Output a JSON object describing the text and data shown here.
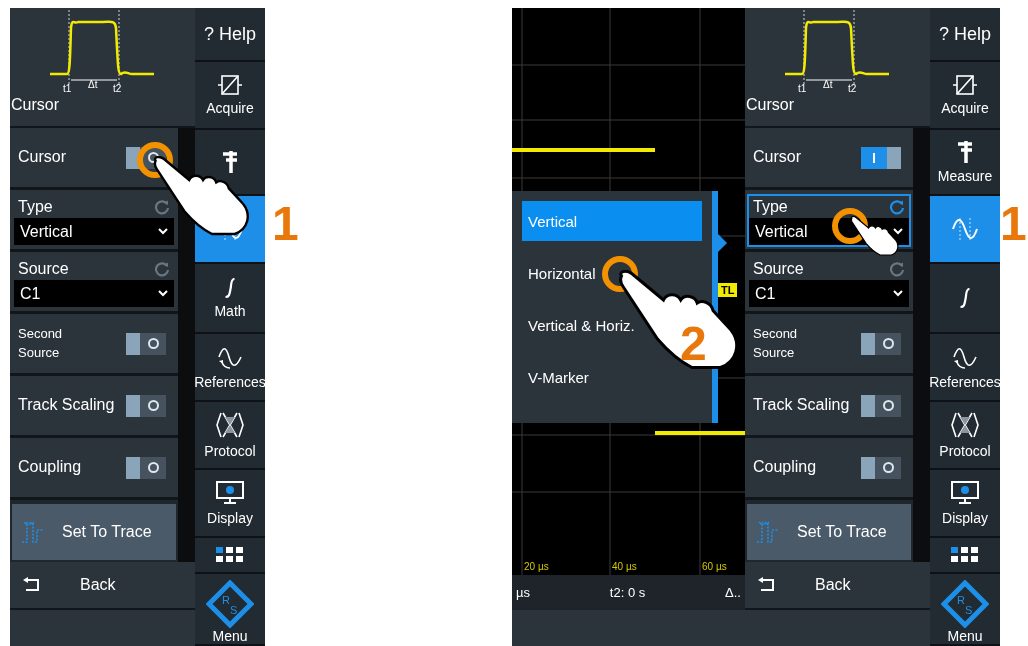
{
  "left_screen": {
    "diagram_labels": [
      "t1",
      "Δt",
      "t2"
    ],
    "title": "Cursor",
    "settings": [
      {
        "kind": "toggle",
        "label": "Cursor",
        "on": false
      },
      {
        "kind": "select",
        "label": "Type",
        "value": "Vertical",
        "highlighted": false
      },
      {
        "kind": "select",
        "label": "Source",
        "value": "C1",
        "highlighted": false
      },
      {
        "kind": "toggle",
        "label": "Second Source",
        "on": false
      },
      {
        "kind": "toggle",
        "label": "Track Scaling",
        "on": false
      },
      {
        "kind": "toggle",
        "label": "Coupling",
        "on": false
      },
      {
        "kind": "action",
        "label": "Set To Trace"
      }
    ],
    "back": "Back",
    "sidebar": [
      {
        "kind": "help",
        "label": "? Help",
        "selected": false
      },
      {
        "kind": "acquire",
        "label": "Acquire",
        "selected": false
      },
      {
        "kind": "measure",
        "selected": false
      },
      {
        "kind": "cursor",
        "selected": true
      },
      {
        "kind": "math",
        "label": "Math",
        "selected": false
      },
      {
        "kind": "references",
        "label": "References",
        "selected": false
      },
      {
        "kind": "protocol",
        "label": "Protocol",
        "selected": false
      },
      {
        "kind": "display",
        "label": "Display",
        "selected": false
      },
      {
        "kind": "apps",
        "selected": false
      },
      {
        "kind": "menu",
        "label": "Menu",
        "logo_letters": [
          "R",
          "S"
        ],
        "selected": false
      }
    ]
  },
  "scope": {
    "menu": [
      {
        "label": "Vertical",
        "selected": true
      },
      {
        "label": "Horizontal",
        "selected": false
      },
      {
        "label": "Vertical & Horiz.",
        "selected": false
      },
      {
        "label": "V-Marker",
        "selected": false
      }
    ],
    "marker": "TL",
    "x_labels": [
      "20 µs",
      "40 µs",
      "60 µs"
    ],
    "status": [
      "µs",
      "t2: 0 s",
      "Δ.."
    ]
  },
  "right_screen": {
    "diagram_labels": [
      "t1",
      "Δt",
      "t2"
    ],
    "title": "Cursor",
    "settings": [
      {
        "kind": "toggle",
        "label": "Cursor",
        "on": true
      },
      {
        "kind": "select",
        "label": "Type",
        "value": "Vertical",
        "highlighted": true
      },
      {
        "kind": "select",
        "label": "Source",
        "value": "C1",
        "highlighted": false
      },
      {
        "kind": "toggle",
        "label": "Second Source",
        "on": false
      },
      {
        "kind": "toggle",
        "label": "Track Scaling",
        "on": false
      },
      {
        "kind": "toggle",
        "label": "Coupling",
        "on": false
      },
      {
        "kind": "action",
        "label": "Set To Trace"
      }
    ],
    "back": "Back",
    "sidebar": [
      {
        "kind": "help",
        "label": "? Help",
        "selected": false
      },
      {
        "kind": "acquire",
        "label": "Acquire",
        "selected": false
      },
      {
        "kind": "measure",
        "label": "Measure",
        "selected": false
      },
      {
        "kind": "cursor",
        "selected": true
      },
      {
        "kind": "math",
        "selected": false
      },
      {
        "kind": "references",
        "label": "References",
        "selected": false
      },
      {
        "kind": "protocol",
        "label": "Protocol",
        "selected": false
      },
      {
        "kind": "display",
        "label": "Display",
        "selected": false
      },
      {
        "kind": "apps",
        "selected": false
      },
      {
        "kind": "menu",
        "label": "Menu",
        "logo_letters": [
          "R",
          "S"
        ],
        "selected": false
      }
    ]
  },
  "callouts": [
    {
      "number": "1"
    },
    {
      "number": "2"
    },
    {
      "number": "1"
    }
  ]
}
